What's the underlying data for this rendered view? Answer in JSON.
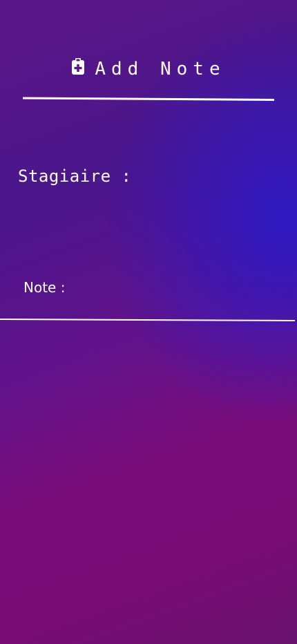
{
  "header": {
    "icon": "clipboard-medical-icon",
    "title": "Add Note"
  },
  "form": {
    "stagiaire_label": "Stagiaire :",
    "note_label": "Note :"
  },
  "colors": {
    "text": "#ffffff",
    "gradient_purple": "#5a1686",
    "gradient_blue": "#2c1ac6",
    "gradient_magenta": "#7a0c78"
  }
}
